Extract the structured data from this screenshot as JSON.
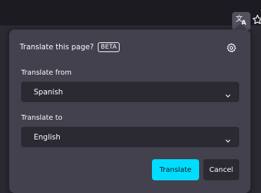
{
  "toolbar": {
    "translate_icon": "translate-icon",
    "star_icon": "star-icon"
  },
  "panel": {
    "title": "Translate this page?",
    "badge": "BETA",
    "settings_icon": "gear-icon",
    "from_label": "Translate from",
    "from_value": "Spanish",
    "to_label": "Translate to",
    "to_value": "English",
    "translate_button": "Translate",
    "cancel_button": "Cancel"
  },
  "colors": {
    "accent": "#00ddff",
    "panel_bg": "#42414d",
    "select_bg": "#2b2a33",
    "toolbar_bg": "#1c1b22"
  }
}
